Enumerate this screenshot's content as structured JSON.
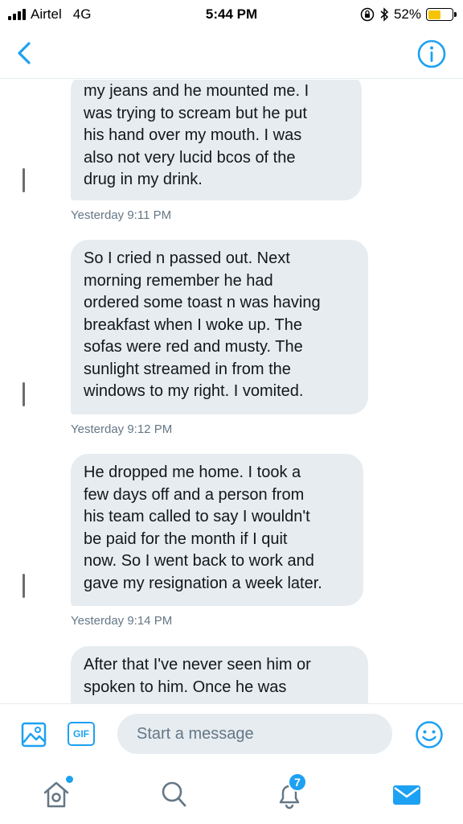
{
  "status_bar": {
    "carrier": "Airtel",
    "network": "4G",
    "time": "5:44 PM",
    "battery_percent": "52%",
    "battery_level": 0.52,
    "battery_color": "#f7c500"
  },
  "nav": {
    "back_icon": "chevron-left-icon",
    "info_icon": "info-icon",
    "accent_color": "#1da1f2"
  },
  "messages": [
    {
      "text": "my jeans and he mounted me. I\nwas trying to scream but he put\nhis hand over my mouth. I was\nalso not very lucid bcos of the\ndrug in my drink.",
      "timestamp": "Yesterday 9:11 PM"
    },
    {
      "text": "So I cried n passed out. Next\nmorning remember he had\nordered some toast n was having\nbreakfast when I woke up. The\nsofas were red and musty. The\nsunlight streamed in from the\nwindows to my right. I vomited.",
      "timestamp": "Yesterday 9:12 PM"
    },
    {
      "text": "He dropped me home. I took a\nfew days off and a person from\nhis team called to say I wouldn't\nbe paid for the month if I quit\nnow. So I went back to work and\ngave my resignation a week later.",
      "timestamp": "Yesterday 9:14 PM"
    },
    {
      "text": "After that I've never seen him or\nspoken to him. Once he was",
      "timestamp": ""
    }
  ],
  "composer": {
    "gif_label": "GIF",
    "placeholder": "Start a message",
    "media_icon": "image-icon",
    "emoji_icon": "smiley-icon"
  },
  "tabs": {
    "home_icon": "home-icon",
    "search_icon": "search-icon",
    "notifications_icon": "bell-icon",
    "notifications_count": "7",
    "messages_icon": "envelope-icon"
  }
}
